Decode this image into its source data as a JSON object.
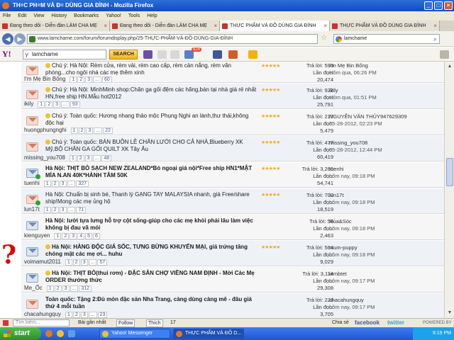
{
  "window": {
    "title": "TH=C PH=M VÀ Đ= DÙNG GIA ĐÌNH - Mozilla Firefox"
  },
  "menu": [
    "File",
    "Edit",
    "View",
    "History",
    "Bookmarks",
    "Yahoo!",
    "Tools",
    "Help"
  ],
  "tabs": [
    {
      "label": "Đang theo dõi - Diễn đàn LÀM CHA MẸ"
    },
    {
      "label": "Đang theo dõi - Diễn đàn LÀM CHA MẸ"
    },
    {
      "label": "THỰC PHẨM VÀ ĐỒ DÙNG GIA ĐÌNH"
    },
    {
      "label": "THỰC PHẨM VÀ ĐỒ DÙNG GIA ĐÌNH"
    }
  ],
  "nav": {
    "url": "www.lamchame.com/forum/forumdisplay.php/25-THỰC-PHẨM-VÀ-ĐỒ-DÙNG-GIA-ĐÌNH",
    "search_value": "lamchame"
  },
  "yahoo": {
    "logo": "Y!",
    "search_value": "lamchame",
    "search_button": "SEARCH",
    "mail_count": "828"
  },
  "threads": [
    {
      "title": "Chú ý: Hà Nội: Rèm cửa, rèm vải, rèm cao cấp, rèm cản nắng, rèm văn phòng...cho ngôi nhà các mẹ thêm xinh",
      "author": "I'm Mẹ Bin Bống",
      "pages": [
        "1",
        "2",
        "3",
        "...",
        "60"
      ],
      "replies": "Trả lời: 596",
      "views": "Lần đọc: 20,474",
      "last_user": "I'm Mẹ Bin Bống",
      "last_time": "Hôm qua, 06:26 PM"
    },
    {
      "title": "Chú ý: Hà Nội: MinhMinh shop:Chăn ga gối đệm các hãng,bán tại nhà giá rẻ nhất HN,free ship HN.Mẫu hot2012",
      "author": "ikily",
      "pages": [
        "1",
        "2",
        "3",
        "...",
        "93"
      ],
      "replies": "Trả lời: 922",
      "views": "Lần đọc: 25,791",
      "last_user": "ikily",
      "last_time": "Hôm qua, 01:51 PM"
    },
    {
      "title": "Chú ý: Toàn quốc: Hương nhang thảo mộc Phụng Nghi an lành,thư thái,không độc hại",
      "author": "huongphungnghi",
      "pages": [
        "1",
        "2",
        "3",
        "...",
        "22"
      ],
      "replies": "Trả lời: 217",
      "views": "Lần đọc: 5,479",
      "last_user": "NGUYỄN VĂN THỦY947629309",
      "last_time": "05-28-2012, 02:23 PM"
    },
    {
      "title": "Chú ý: Toàn quốc: BÁN BUÔN LẺ CHĂN LƯỚI CHO CẢ NHÀ,Blueberry XK Mỹ,BỘ CHĂN GA GỐI QUILT XK Tây Âu",
      "author": "missing_you708",
      "pages": [
        "1",
        "2",
        "3",
        "...",
        "48"
      ],
      "replies": "Trả lời: 477",
      "views": "Lần đọc: 60,419",
      "last_user": "missing_you708",
      "last_time": "05-28-2012, 12:44 PM"
    },
    {
      "title": "Hà Nội: THỊT BÒ SẠCH NEW ZEALAND*Bò ngoại giá nội*Free ship HN1*MẬT MÍA N.AN 40K*HÀNH TĂM 50K",
      "author": "tuenhi",
      "pages": [
        "1",
        "2",
        "3",
        "...",
        "327"
      ],
      "replies": "Trả lời: 3,266",
      "views": "Lần đọc: 54,741",
      "last_user": "tuenhi",
      "last_time": "hôm nay, 09:18 PM"
    },
    {
      "title": "Hà Nội: Chuẩn bị sinh bé, Thanh lý GẠNG TAY MALAYSIA nhanh, giá Free/share ship!Mong các mẹ ủng hộ",
      "author": "lun17t",
      "pages": [
        "1",
        "2",
        "3",
        "...",
        "71"
      ],
      "replies": "Trả lời: 702",
      "views": "Lần đọc: 18,519",
      "last_user": "lun17t",
      "last_time": "hôm nay, 09:18 PM"
    },
    {
      "title": "Hà Nội: lưới tựa lưng hỗ trợ cột sống-giúp cho các mẹ khỏi phải lâu làm việc không bị đau vã mỏi",
      "author": "kienguyen",
      "pages": [
        "1",
        "2",
        "3",
        "4",
        "5",
        "6"
      ],
      "replies": "Trả lời: 56",
      "views": "Lần đọc: 2,463",
      "last_user": "Rùa&Sóc",
      "last_time": "hôm nay, 09:18 PM"
    },
    {
      "title": "Hà Nội: HÀNG ĐỘC GIÁ SỐC, TƯNG BỪNG KHUYẾN MẠI, giá trứng tăng chóng mặt các mẹ ơi... huhu",
      "author": "voimamut2011",
      "pages": [
        "1",
        "2",
        "3",
        "...",
        "57"
      ],
      "replies": "Trả lời: 564",
      "views": "Lần đọc: 9,029",
      "last_user": "mum-puppy",
      "last_time": "hôm nay, 09:18 PM"
    },
    {
      "title": "Hà Nội: THỊT BÒ(thui rơm) - ĐẶC SẢN CHỢ VIỀNG NAM ĐỊNH - Mời Các Mẹ ORDER thưởng thức",
      "author": "Me_Ốc",
      "pages": [
        "1",
        "2",
        "3",
        "...",
        "312"
      ],
      "replies": "Trả lời: 3,114",
      "views": "Lần đọc: 29,308",
      "last_user": "iembtet",
      "last_time": "hôm nay, 09:17 PM"
    },
    {
      "title": "Toàn quốc: Tặng 2:Đủ món đặc sản Nha Trang, càng dùng càng mê - đâu giá thứ 4 mỗi tuần",
      "author": "chacahungquy",
      "pages": [
        "1",
        "2",
        "3",
        "...",
        "23"
      ],
      "replies": "Trả lời: 228",
      "views": "Lần đọc: 3,705",
      "last_user": "chacahungquy",
      "last_time": "hôm nay, 09:17 PM"
    }
  ],
  "statusbar": {
    "left": "Tìm kiếm...",
    "post": "Bài gần nhất",
    "follow": "Follow",
    "like": "Thích",
    "like_count": "17",
    "share": "Chia sẻ",
    "facebook": "facebook",
    "twitter": "twitter",
    "powered": "POWERED BY wibiya"
  },
  "taskbar": {
    "start": "start",
    "task1": "Yahoo! Messenger",
    "task2": "THỰC PHẨM VÀ ĐỒ D...",
    "time": "9:19 PM"
  }
}
